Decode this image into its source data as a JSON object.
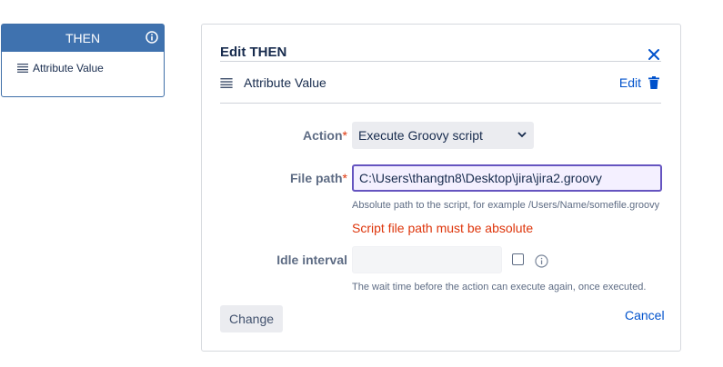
{
  "then_card": {
    "title": "THEN",
    "info_icon": "info-circle-icon",
    "item_icon": "menu-lines-icon",
    "item_label": "Attribute Value"
  },
  "panel": {
    "title": "Edit THEN",
    "close_icon": "close-icon",
    "attribute_icon": "menu-lines-icon",
    "attribute_label": "Attribute Value",
    "edit_label": "Edit",
    "delete_icon": "trash-icon"
  },
  "form": {
    "action": {
      "label": "Action",
      "required_mark": "*",
      "selected": "Execute Groovy script"
    },
    "file_path": {
      "label": "File path",
      "required_mark": "*",
      "value": "C:\\Users\\thangtn8\\Desktop\\jira\\jira2.groovy",
      "help": "Absolute path to the script, for example /Users/Name/somefile.groovy",
      "error": "Script file path must be absolute"
    },
    "idle_interval": {
      "label": "Idle interval",
      "value": "",
      "checked": false,
      "help": "The wait time before the action can execute again, once executed."
    }
  },
  "buttons": {
    "change": "Change",
    "cancel": "Cancel"
  },
  "colors": {
    "header_blue": "#3f72af",
    "link_blue": "#0052cc",
    "error_red": "#de350b",
    "focus_purple": "#6554c0"
  }
}
